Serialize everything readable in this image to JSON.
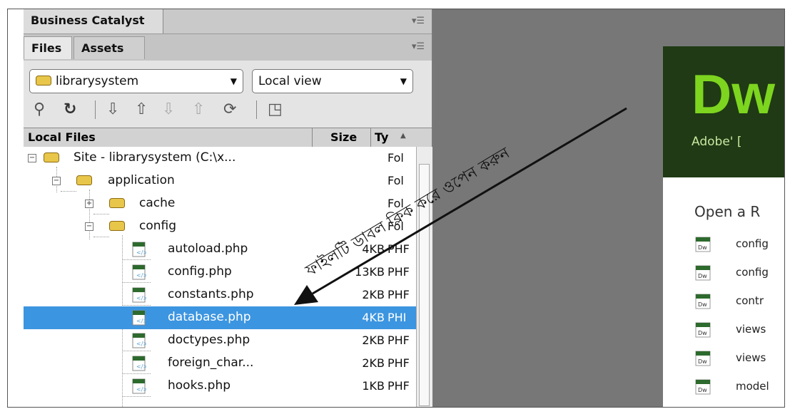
{
  "panel": {
    "tab_business_catalyst": "Business Catalyst",
    "tab_files": "Files",
    "tab_assets": "Assets",
    "site_dropdown": "librarysystem",
    "view_dropdown": "Local view",
    "header": {
      "local_files": "Local Files",
      "size": "Size",
      "type": "Ty"
    }
  },
  "files": [
    {
      "name": "Site - librarysystem (C:\\x...",
      "size": "",
      "type": "Fol"
    },
    {
      "name": "application",
      "size": "",
      "type": "Fol"
    },
    {
      "name": "cache",
      "size": "",
      "type": "Fol"
    },
    {
      "name": "config",
      "size": "",
      "type": "Fol"
    },
    {
      "name": "autoload.php",
      "size": "4KB",
      "type": "PHF"
    },
    {
      "name": "config.php",
      "size": "13KB",
      "type": "PHF"
    },
    {
      "name": "constants.php",
      "size": "2KB",
      "type": "PHF"
    },
    {
      "name": "database.php",
      "size": "4KB",
      "type": "PHI"
    },
    {
      "name": "doctypes.php",
      "size": "2KB",
      "type": "PHF"
    },
    {
      "name": "foreign_char...",
      "size": "2KB",
      "type": "PHF"
    },
    {
      "name": "hooks.php",
      "size": "1KB",
      "type": "PHF"
    }
  ],
  "welcome": {
    "logo": "Dw",
    "subtitle": "Adobe' [",
    "open_recent": "Open a R",
    "recent_files": [
      "config",
      "config",
      "contr",
      "views",
      "views",
      "model"
    ]
  },
  "annotation": {
    "text": "ফাইলটি ডাবল ক্লিক করে ওপেন করুন"
  },
  "colors": {
    "selection": "#3c95e0",
    "dw_green": "#7dd51f",
    "dw_banner": "#1f3a14"
  }
}
